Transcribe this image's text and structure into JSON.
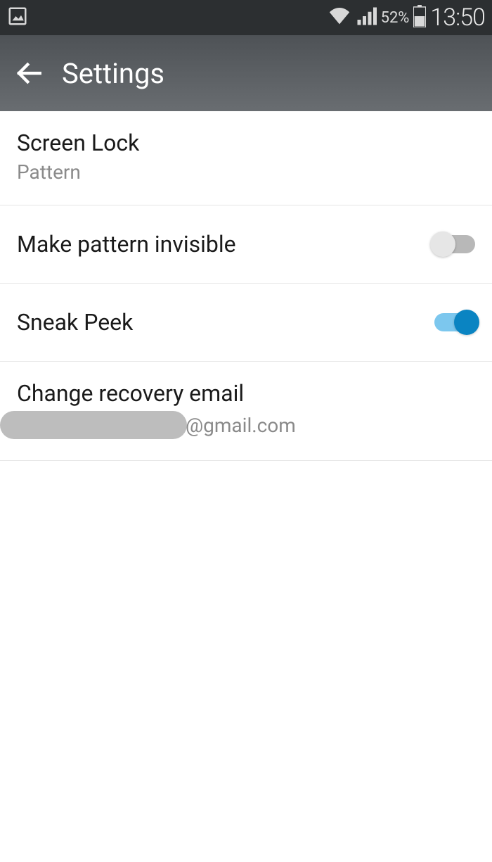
{
  "statusBar": {
    "batteryPercent": "52%",
    "time": "13:50"
  },
  "header": {
    "title": "Settings"
  },
  "settings": {
    "screenLock": {
      "title": "Screen Lock",
      "value": "Pattern"
    },
    "makePatternInvisible": {
      "title": "Make pattern invisible",
      "enabled": false
    },
    "sneakPeek": {
      "title": "Sneak Peek",
      "enabled": true
    },
    "recoveryEmail": {
      "title": "Change recovery email",
      "emailSuffix": "@gmail.com"
    }
  }
}
